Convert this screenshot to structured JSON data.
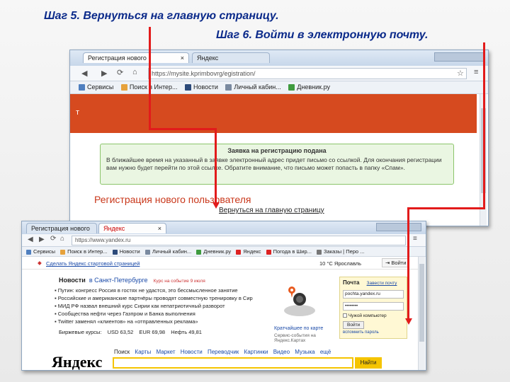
{
  "headings": {
    "step5": "Шаг 5. Вернуться на главную страницу.",
    "step6": "Шаг 6. Войти в электронную почту."
  },
  "window1": {
    "tabs": [
      "Регистрация нового",
      "Яндекс"
    ],
    "url": "https://mysite.kprimbovrg/egistration/",
    "bookmarks": [
      "Сервисы",
      "Поиск в Интер...",
      "Новости",
      "Личный кабин...",
      "Дневник.ру"
    ],
    "top_letter": "т",
    "success_title": "Заявка на регистрацию подана",
    "success_text": "В ближайшее время на указанный в заявке электронный адрес придет письмо со ссылкой. Для окончания регистрации вам нужно будет перейти по этой ссылке. Обратите внимание, что письмо может попасть в папку «Спам».",
    "reg_title": "Регистрация нового пользователя",
    "back_link": "Вернуться на главную страницу"
  },
  "window2": {
    "tabs": [
      "Регистрация нового",
      "Яндекс"
    ],
    "url": "https://www.yandex.ru",
    "bookmarks": [
      "Сервисы",
      "Поиск в Интер...",
      "Новости",
      "Личный кабин...",
      "Дневник.ру",
      "Яндекс",
      "Погода в Шир...",
      "Заказы | Перо ..."
    ],
    "make_home": "Сделать Яндекс стартовой страницей",
    "weather": "10 °С  Ярославль",
    "login_btn": "Войти",
    "news_tab": "Новости",
    "news_region": "в Санкт-Петербурге",
    "news_date": "Курс на событие 9 июля",
    "news_items": [
      "Путин: конгресс Россия в гостях не удастся, это бессмысленное занятие",
      "Российские и американские партнёры проводят совместную тренировку в Сирии",
      "МИД РФ назвал внешний курс Сирии как непатриотичный разворот",
      "Сообщества нефти через Газпром и Банка выполнения",
      "Twitter заменял «клиентов» на «отправленных реклама»"
    ],
    "rates_label": "Биржевые курсы:",
    "rates": [
      "USD 63,52",
      "EUR 69,98",
      "Нефть 49,81"
    ],
    "map_caption": "Кратчайшее по карте",
    "map_sub": "Сервис-события на Яндекс.Картах",
    "mail_title": "Почта",
    "mail_link": "Завести почту",
    "login_value": "pochta.yandex.ru",
    "password_value": "••••••••",
    "remember_label": "Чужой компьютер",
    "mail_submit": "Войти",
    "mail_forgot": "вспомнить пароль",
    "logo": "Яндекс",
    "search_tabs": [
      "Поиск",
      "Карты",
      "Маркет",
      "Новости",
      "Переводчик",
      "Картинки",
      "Видео",
      "Музыка",
      "ещё"
    ],
    "search_button": "Найти"
  },
  "colors": {
    "accent_red": "#e21b1b",
    "orange_banner": "#d64a1f",
    "heading_blue": "#0b2a8a",
    "success_green": "#8cc56b"
  }
}
